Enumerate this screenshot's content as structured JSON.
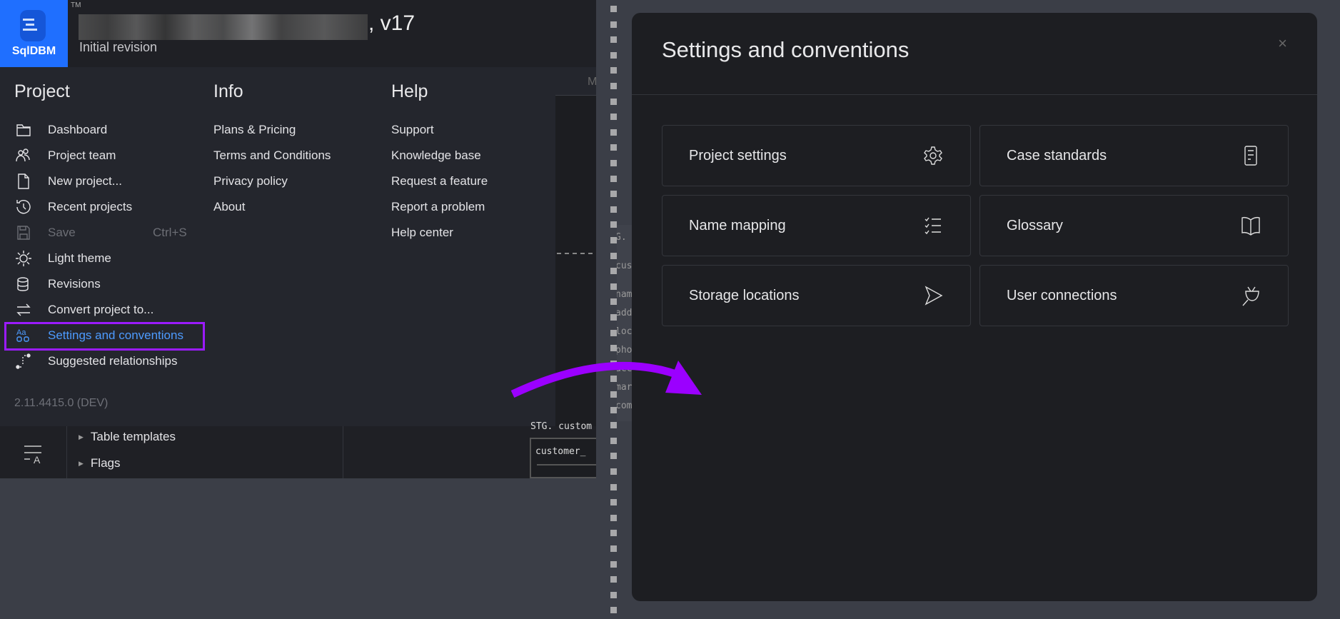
{
  "header": {
    "logo": "SqlDBM",
    "trademark": "TM",
    "project_version": ", v17",
    "revision": "Initial revision"
  },
  "menu": {
    "project": {
      "heading": "Project",
      "items": [
        {
          "label": "Dashboard",
          "icon": "folder-icon"
        },
        {
          "label": "Project team",
          "icon": "users-icon"
        },
        {
          "label": "New project...",
          "icon": "file-icon"
        },
        {
          "label": "Recent projects",
          "icon": "history-icon"
        },
        {
          "label": "Save",
          "shortcut": "Ctrl+S",
          "icon": "save-icon",
          "disabled": true
        },
        {
          "label": "Light theme",
          "icon": "sun-icon"
        },
        {
          "label": "Revisions",
          "icon": "database-icon"
        },
        {
          "label": "Convert project to...",
          "icon": "swap-icon"
        },
        {
          "label": "Settings and conventions",
          "icon": "text-style-icon",
          "selected": true
        },
        {
          "label": "Suggested relationships",
          "icon": "relationship-icon"
        }
      ]
    },
    "info": {
      "heading": "Info",
      "items": [
        "Plans & Pricing",
        "Terms and Conditions",
        "Privacy policy",
        "About"
      ]
    },
    "help": {
      "heading": "Help",
      "items": [
        "Support",
        "Knowledge base",
        "Request a feature",
        "Report a problem",
        "Help center"
      ]
    },
    "version": "2.11.4415.0 (DEV)"
  },
  "bottom": {
    "tree": [
      "Table templates",
      "Flags"
    ]
  },
  "canvas": {
    "header_letter": "M",
    "table_schema": "STG. custom",
    "table_row": "customer_",
    "frag_lines": [
      "G.",
      "cus",
      "nam",
      "add",
      "loc",
      "pho",
      "acc",
      "mar",
      "com"
    ]
  },
  "modal": {
    "title": "Settings and conventions",
    "close": "×",
    "cards": [
      {
        "label": "Project settings",
        "icon": "gear-icon"
      },
      {
        "label": "Case standards",
        "icon": "document-icon"
      },
      {
        "label": "Name mapping",
        "icon": "checklist-icon"
      },
      {
        "label": "Glossary",
        "icon": "book-icon"
      },
      {
        "label": "Storage locations",
        "icon": "send-icon"
      },
      {
        "label": "User connections",
        "icon": "plug-icon"
      }
    ]
  },
  "colors": {
    "accent": "#1f6fff",
    "highlight": "#9b1bff",
    "selected_text": "#4d9bff"
  }
}
